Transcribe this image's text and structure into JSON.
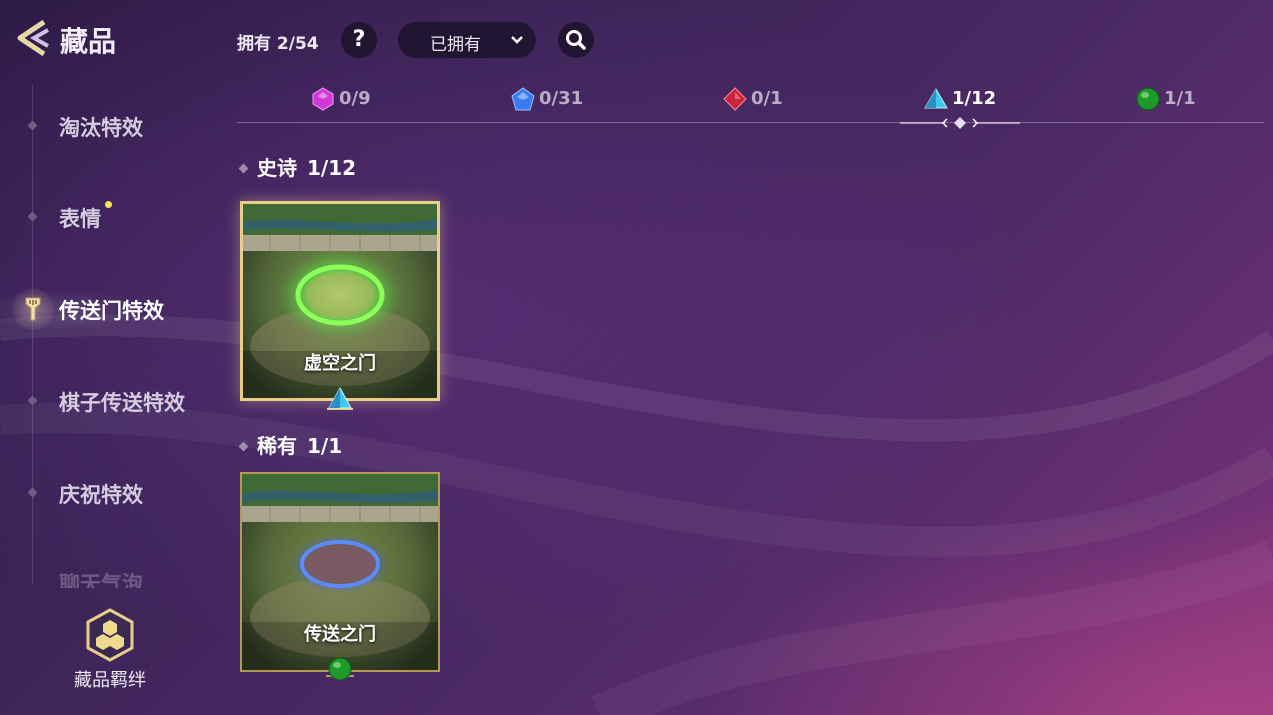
{
  "header": {
    "title": "藏品",
    "owned_label": "拥有 2/54",
    "help_label": "?",
    "filter_value": "已拥有"
  },
  "rarity_tabs": [
    {
      "count": "0/9",
      "gem": "purple-gem-icon",
      "color": "#d13ad6"
    },
    {
      "count": "0/31",
      "gem": "blue-gem-icon",
      "color": "#3a7bf0"
    },
    {
      "count": "0/1",
      "gem": "red-gem-icon",
      "color": "#c8243c"
    },
    {
      "count": "1/12",
      "gem": "cyan-triangle-gem-icon",
      "color": "#3ec8f0",
      "active": true
    },
    {
      "count": "1/1",
      "gem": "green-orb-icon",
      "color": "#1f9a2a"
    }
  ],
  "sidebar": {
    "items": [
      {
        "label": "淘汰特效"
      },
      {
        "label": "表情",
        "new": true
      },
      {
        "label": "传送门特效",
        "active": true
      },
      {
        "label": "棋子传送特效"
      },
      {
        "label": "庆祝特效"
      },
      {
        "label": "聊天气泡"
      }
    ],
    "collection_set_label": "藏品羁绊"
  },
  "sections": [
    {
      "name": "史诗",
      "count": "1/12",
      "cards": [
        {
          "name": "虚空之门",
          "portal": "green",
          "gem": "cyan-triangle-gem-icon"
        }
      ]
    },
    {
      "name": "稀有",
      "count": "1/1",
      "cards": [
        {
          "name": "传送之门",
          "portal": "blue",
          "gem": "green-orb-icon"
        }
      ]
    }
  ],
  "colors": {
    "accent_gold": "#e7cf88",
    "panel_dark": "#211632"
  }
}
